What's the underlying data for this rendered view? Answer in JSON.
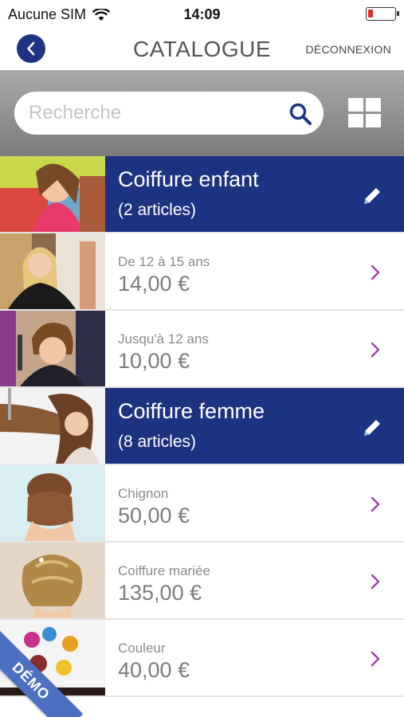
{
  "status_bar": {
    "carrier": "Aucune SIM",
    "time": "14:09"
  },
  "nav": {
    "title": "CATALOGUE",
    "logout_label": "DÉCONNEXION"
  },
  "search": {
    "placeholder": "Recherche"
  },
  "categories": [
    {
      "title": "Coiffure enfant",
      "count": "(2 articles)",
      "items": [
        {
          "name": "De 12 à 15 ans",
          "price": "14,00 €"
        },
        {
          "name": "Jusqu'à 12 ans",
          "price": "10,00 €"
        }
      ]
    },
    {
      "title": "Coiffure femme",
      "count": "(8 articles)",
      "items": [
        {
          "name": "Chignon",
          "price": "50,00 €"
        },
        {
          "name": "Coiffure mariée",
          "price": "135,00 €"
        },
        {
          "name": "Couleur",
          "price": "40,00 €"
        }
      ]
    }
  ],
  "ribbon": {
    "label": "DÉMO"
  },
  "colors": {
    "accent": "#1e3282",
    "chevron": "#a040a8",
    "search_band": "#8f8f8f"
  }
}
